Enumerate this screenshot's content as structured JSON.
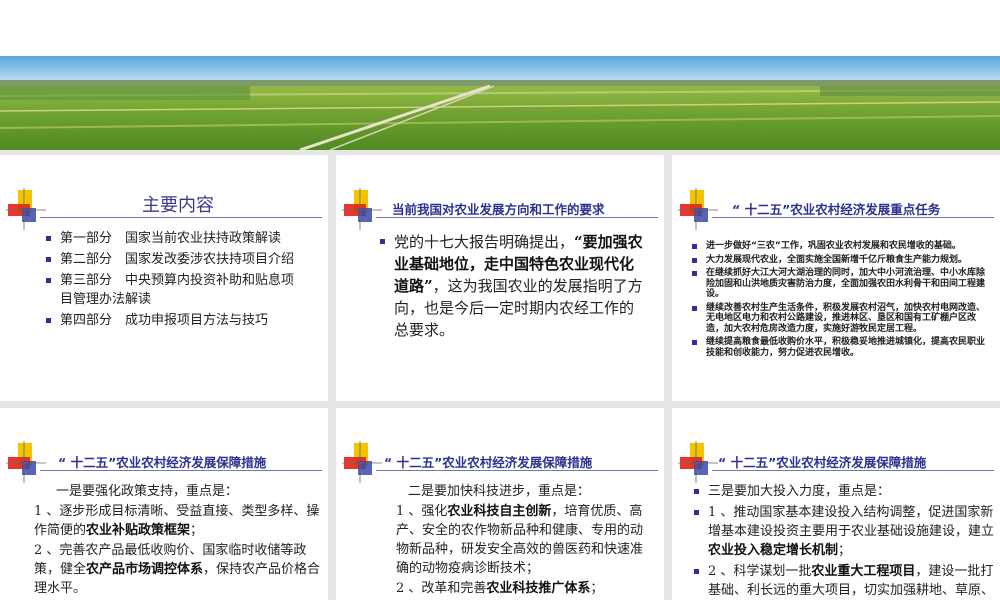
{
  "cards": [
    {
      "title": "主要内容",
      "items": [
        "第一部分　国家当前农业扶持政策解读",
        "第二部分　国家发改委涉农扶持项目介绍",
        "第三部分　中央预算内投资补助和贴息项　目管理办法解读",
        "第四部分　成功申报项目方法与技巧"
      ]
    },
    {
      "title": "当前我国对农业发展方向和工作的要求",
      "text_a": "党的十七大报告明确提出，",
      "text_bold": "“要加强农业基础地位，走中国特色农业现代化道路”",
      "text_b": "，这为我国农业的发展指明了方向，也是今后一定时期内农经工作的总要求。"
    },
    {
      "title": "“ 十二五”农业农村经济发展重点任务",
      "items": [
        "进一步做好“三农”工作，巩固农业农村发展和农民增收的基础。",
        "大力发展现代农业，全面实施全国新增千亿斤粮食生产能力规划。",
        "在继续抓好大江大河大湖治理的同时，加大中小河流治理、中小水库除险加固和山洪地质灾害防治力度，全面加强农田水利骨干和田间工程建设。",
        "继续改善农村生产生活条件，积极发展农村沼气，加快农村电网改造、无电地区电力和农村公路建设，推进林区、垦区和国有工矿棚户区改造，加大农村危房改造力度，实施好游牧民定居工程。",
        "继续提高粮食最低收购价水平，积极稳妥地推进城镇化，提高农民职业技能和创收能力，努力促进农民增收。"
      ]
    },
    {
      "title": "“ 十二五”农业农村经济发展保障措施",
      "intro": "一是要强化政策支持，重点是：",
      "p1_a": "1 、逐步形成目标清晰、受益直接、类型多样、操作简便的",
      "p1_bold": "农业补贴政策框架",
      "p1_b": "；",
      "p2_a": "2 、完善农产品最低收购价、国家临时收储等政策，健全",
      "p2_bold": "农产品市场调控体系",
      "p2_b": "，保持农产品价格合理水平。"
    },
    {
      "title": "“ 十二五”农业农村经济发展保障措施",
      "intro": "二是要加快科技进步，重点是：",
      "p1_a": "1 、强化",
      "p1_bold": "农业科技自主创新",
      "p1_b": "，培育优质、高产、安全的农作物新品种和健康、专用的动物新品种，研发安全高效的兽医药和快速准确的动物疫病诊断技术；",
      "p2_a": "2 、改革和完善",
      "p2_bold": "农业科技推广体系",
      "p2_b": "；"
    },
    {
      "title": "“ 十二五”农业农村经济发展保障措施",
      "intro": "三是要加大投入力度，重点是：",
      "p1_a": "1 、推动国家基本建设投入结构调整，促进国家新增基本建设投资主要用于农业基础设施建设，建立",
      "p1_bold": "农业投入稳定增长机制",
      "p1_b": "；",
      "p2_a": "2 、科学谋划一批",
      "p2_bold": "农业重大工程项目",
      "p2_b": "，建设一批打基础、利长远的重大项目，切实加强耕地、草原、水域滩涂保护与建设。"
    }
  ]
}
